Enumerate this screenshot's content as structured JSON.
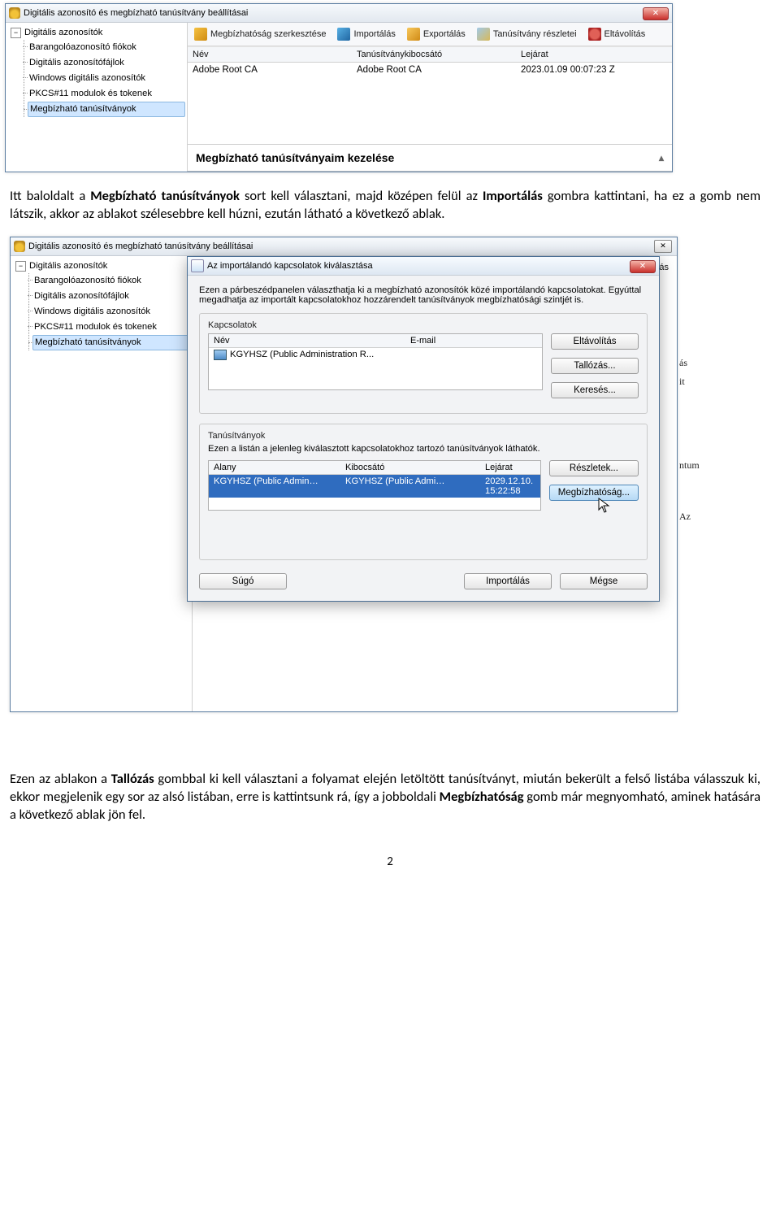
{
  "window1": {
    "title": "Digitális azonosító és megbízható tanúsítvány beállításai",
    "tree": {
      "root": "Digitális azonosítók",
      "items": [
        "Barangolóazonosító fiókok",
        "Digitális azonosítófájlok",
        "Windows digitális azonosítók",
        "PKCS#11 modulok és tokenek"
      ],
      "selected": "Megbízható tanúsítványok"
    },
    "toolbar": {
      "edit": "Megbízhatóság szerkesztése",
      "import": "Importálás",
      "export": "Exportálás",
      "detail": "Tanúsítvány részletei",
      "remove": "Eltávolítás"
    },
    "list_header": {
      "name": "Név",
      "issuer": "Tanúsítványkibocsátó",
      "expiry": "Lejárat"
    },
    "list_rows": [
      {
        "name": "Adobe Root CA",
        "issuer": "Adobe Root CA",
        "expiry": "2023.01.09 00:07:23 Z"
      }
    ],
    "section_title": "Megbízható tanúsítványaim kezelése"
  },
  "para1_full": "Itt baloldalt a Megbízható tanúsítványok sort kell választani, majd középen felül az Importálás gombra kattintani, ha ez a gomb nem látszik, akkor az ablakot szélesebbre kell húzni, ezután látható a következő ablak.",
  "para1": {
    "p1a": "Itt baloldalt a ",
    "p1b_bold": "Megbízható tanúsítványok",
    "p1c": " sort kell választani, majd középen felül az ",
    "p1d_bold": "Importálás",
    "p1e": " gombra kattintani, ha ez a gomb nem látszik, akkor az ablakot szélesebbre kell húzni, ezután látható a következő ablak."
  },
  "window2": {
    "title": "Digitális azonosító és megbízható tanúsítvány beállításai",
    "tree": {
      "root": "Digitális azonosítók",
      "items": [
        "Barangolóazonosító fiókok",
        "Digitális azonosítófájlok",
        "Windows digitális azonosítók",
        "PKCS#11 modulok és tokenek"
      ],
      "selected": "Megbízható tanúsítványok"
    },
    "peek_remove": "volítás",
    "far_lines": [
      "ás",
      "it",
      "ntum",
      "Az"
    ]
  },
  "dialog": {
    "title": "Az importálandó kapcsolatok kiválasztása",
    "intro": "Ezen a párbeszédpanelen választhatja ki a megbízható azonosítók közé importálandó kapcsolatokat. Egyúttal megadhatja az importált kapcsolatokhoz hozzárendelt tanúsítványok megbízhatósági szintjét is.",
    "contacts_label": "Kapcsolatok",
    "contacts_header": {
      "name": "Név",
      "email": "E-mail"
    },
    "contact_row": "KGYHSZ (Public Administration R...",
    "btn_remove": "Eltávolítás",
    "btn_browse": "Tallózás...",
    "btn_search": "Keresés...",
    "certs_label": "Tanúsítványok",
    "certs_note": "Ezen a listán a jelenleg kiválasztott kapcsolatokhoz tartozó tanúsítványok láthatók.",
    "certs_header": {
      "subject": "Alany",
      "issuer": "Kibocsátó",
      "expiry": "Lejárat"
    },
    "cert_row": {
      "subject": "KGYHSZ (Public Admin…",
      "issuer": "KGYHSZ (Public Admi…",
      "expiry": "2029.12.10. 15:22:58"
    },
    "btn_detail": "Részletek...",
    "btn_trust": "Megbízhatóság...",
    "btn_help": "Súgó",
    "btn_import": "Importálás",
    "btn_cancel": "Mégse"
  },
  "para2_full": "Ezen az ablakon a Tallózás gombbal ki kell választani a folyamat elején letöltött tanúsítványt, miután bekerült a felső listába válasszuk ki, ekkor megjelenik egy sor az alsó listában, erre is kattintsunk rá, így a jobboldali Megbízhatóság gomb már megnyomható, aminek hatására a következő ablak jön fel.",
  "para2": {
    "a": "Ezen az ablakon a ",
    "b_bold": "Tallózás",
    "c": " gombbal ki kell választani a folyamat elején letöltött tanúsítványt, miután bekerült a felső listába válasszuk ki, ekkor megjelenik egy sor az alsó listában, erre is kattintsunk rá, így a jobboldali ",
    "d_bold": "Megbízhatóság",
    "e": " gomb már megnyomható, aminek hatására a következő ablak jön fel."
  },
  "page_number": "2"
}
